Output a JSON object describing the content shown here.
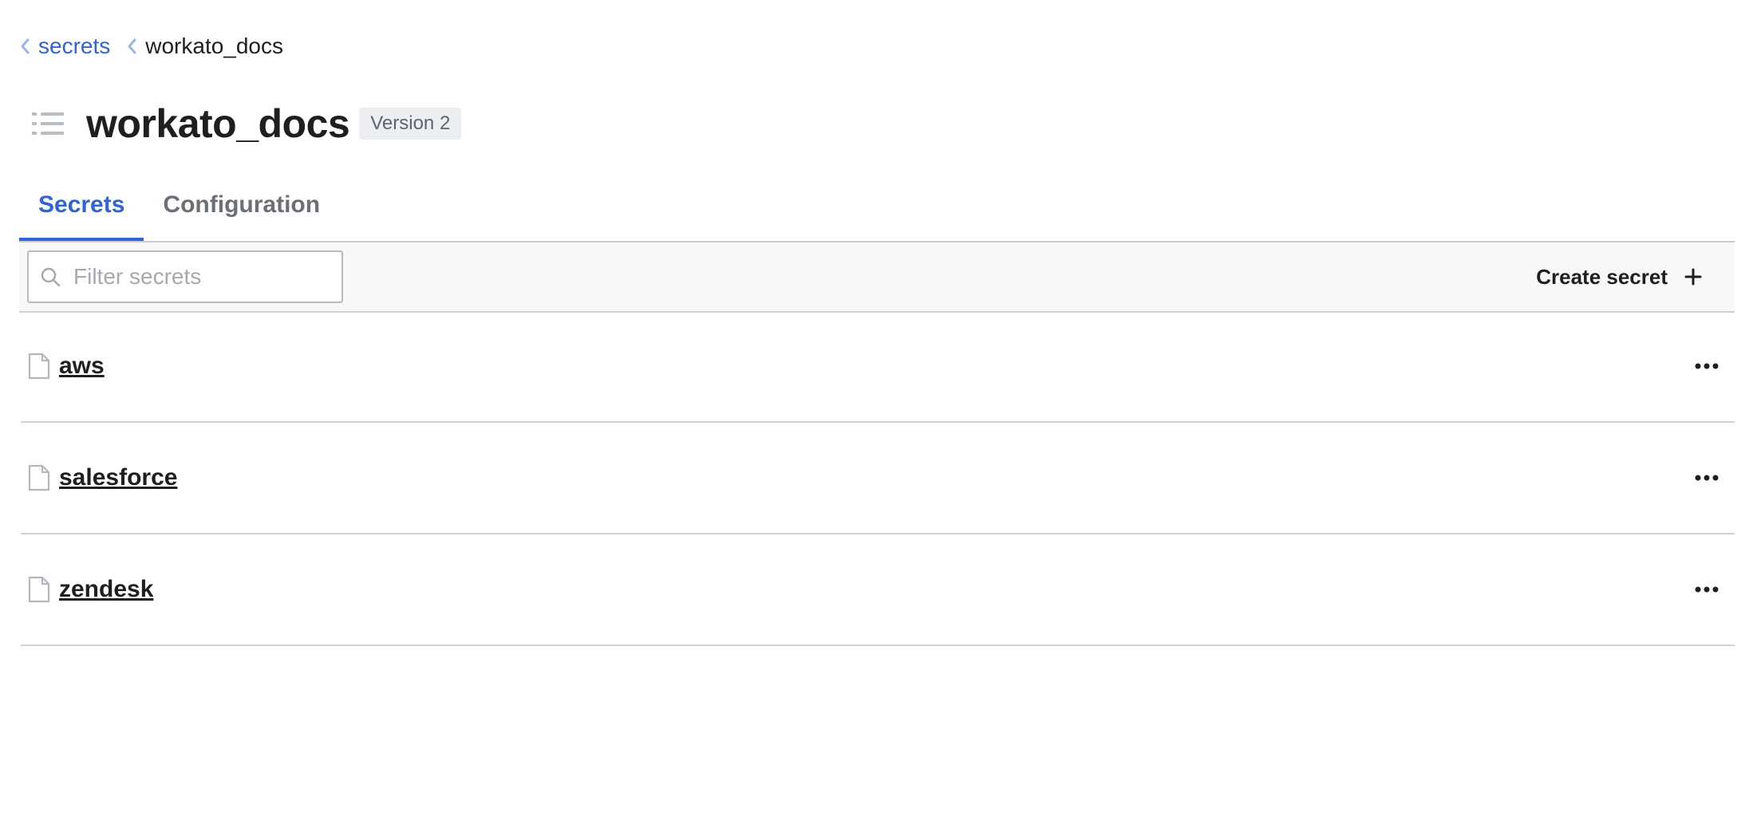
{
  "breadcrumb": {
    "items": [
      {
        "label": "secrets"
      },
      {
        "label": "workato_docs"
      }
    ]
  },
  "page": {
    "title": "workato_docs",
    "version": "Version 2"
  },
  "tabs": [
    {
      "label": "Secrets",
      "active": true
    },
    {
      "label": "Configuration",
      "active": false
    }
  ],
  "toolbar": {
    "search_placeholder": "Filter secrets",
    "search_value": "",
    "create_label": "Create secret"
  },
  "secrets": [
    {
      "name": " aws"
    },
    {
      "name": " salesforce"
    },
    {
      "name": " zendesk"
    }
  ],
  "colors": {
    "accent": "#2f63d6",
    "border": "#cfd3d9",
    "badge_bg": "#eceef1"
  },
  "icons": {
    "breadcrumb_separator": "chevron-left-icon",
    "title": "list-icon",
    "search": "search-icon",
    "create": "plus-icon",
    "row": "file-icon",
    "row_menu": "more-horizontal-icon"
  }
}
